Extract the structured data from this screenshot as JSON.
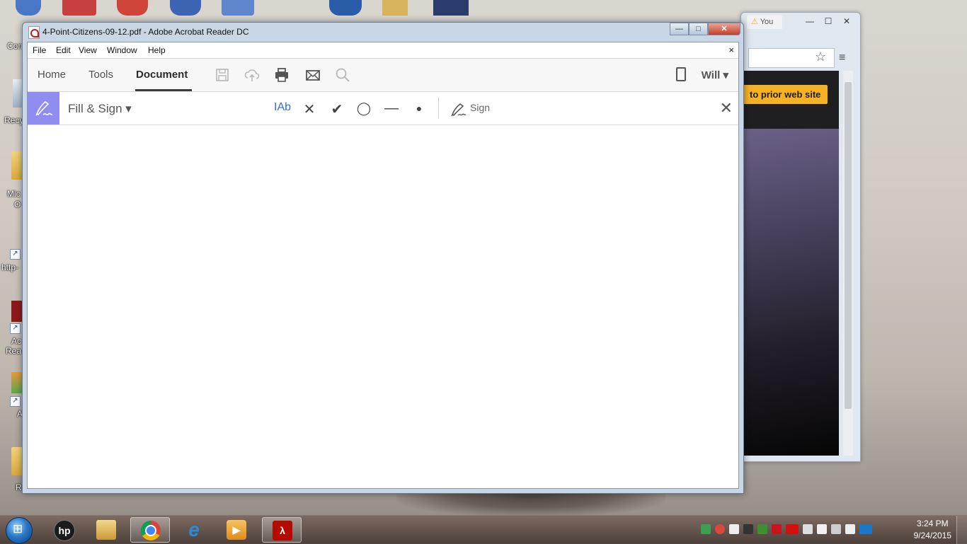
{
  "desktop": {
    "icon_labels": [
      "Con",
      "Recy",
      "Mic",
      "O",
      "http-",
      "Ac",
      "Rea",
      "A",
      "R"
    ]
  },
  "browser": {
    "tab_label": "You",
    "orange_button": "to prior web site",
    "ctrl_min": "—",
    "ctrl_max": "☐",
    "ctrl_close": "✕",
    "star": "☆",
    "menu": "≡"
  },
  "acrobat": {
    "window_title": "4-Point-Citizens-09-12.pdf - Adobe Acrobat Reader DC",
    "title_min": "—",
    "title_max": "□",
    "title_close": "✕",
    "menu": [
      "File",
      "Edit",
      "View",
      "Window",
      "Help"
    ],
    "doc_close": "×",
    "tabs": [
      "Home",
      "Tools",
      "Document"
    ],
    "active_tab": "Document",
    "toolbar_icons": [
      "save-icon",
      "cloud-upload-icon",
      "print-icon",
      "email-icon",
      "search-icon"
    ],
    "user_label": "Will ▾",
    "fill_sign": {
      "title": "Fill & Sign ▾",
      "tools": {
        "text": "Ab",
        "cross": "✕",
        "check": "✔",
        "circle": "◯",
        "line": "—",
        "dot": "●"
      },
      "sign_label": "Sign",
      "close": "✕"
    }
  },
  "taskbar": {
    "apps": [
      "hp",
      "file-explorer",
      "chrome",
      "internet-explorer",
      "media-player",
      "acrobat-reader"
    ],
    "active_app": "acrobat-reader",
    "clock_time": "3:24 PM",
    "clock_date": "9/24/2015"
  }
}
